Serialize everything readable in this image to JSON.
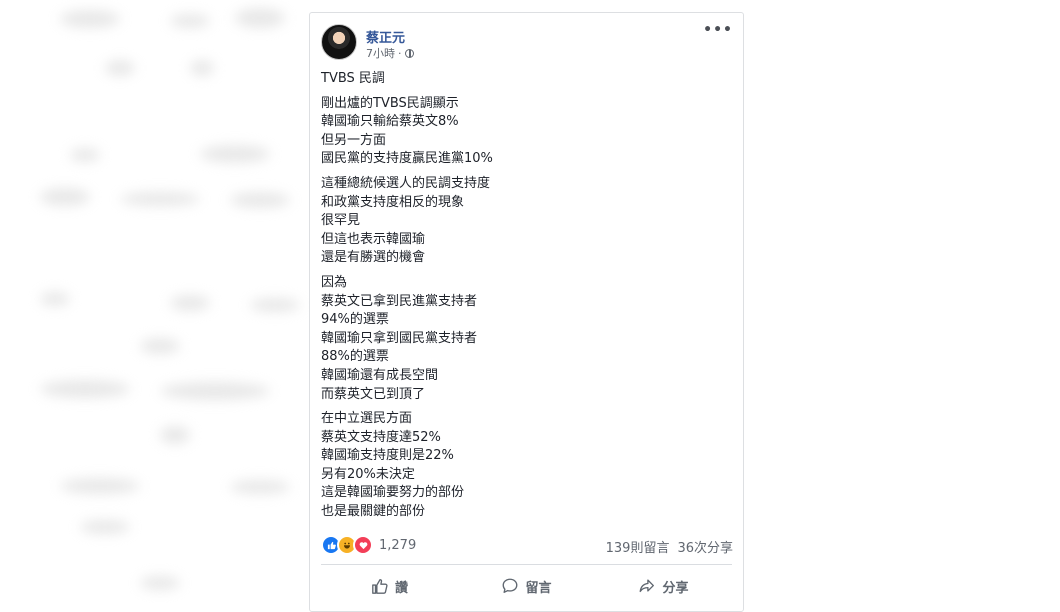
{
  "post": {
    "author": "蔡正元",
    "time": "7小時",
    "separator": "·",
    "title": "TVBS 民調",
    "paragraphs": [
      [
        "剛出爐的TVBS民調顯示",
        "韓國瑜只輸給蔡英文8%",
        "但另一方面",
        "國民黨的支持度贏民進黨10%"
      ],
      [
        "這種總統候選人的民調支持度",
        "和政黨支持度相反的現象",
        "很罕見",
        "但這也表示韓國瑜",
        "還是有勝選的機會"
      ],
      [
        "因為",
        "蔡英文已拿到民進黨支持者",
        "94%的選票",
        "韓國瑜只拿到國民黨支持者",
        "88%的選票",
        "韓國瑜還有成長空間",
        "而蔡英文已到頂了"
      ],
      [
        "在中立選民方面",
        "蔡英文支持度達52%",
        "韓國瑜支持度則是22%",
        "另有20%未決定",
        "這是韓國瑜要努力的部份",
        "也是最關鍵的部份"
      ]
    ]
  },
  "footer": {
    "reaction_count": "1,279",
    "comments": "139則留言",
    "shares": "36次分享",
    "like_label": "讚",
    "comment_label": "留言",
    "share_label": "分享"
  },
  "icons": {
    "more": "more-options-icon",
    "privacy": "globe-icon",
    "like": "thumbs-up-icon",
    "comment": "speech-bubble-icon",
    "share": "share-arrow-icon"
  },
  "colors": {
    "author": "#365899",
    "text": "#1d2129",
    "muted": "#616770",
    "like_reaction": "#1877f2",
    "haha_reaction": "#f7b125",
    "love_reaction": "#f33e58"
  }
}
